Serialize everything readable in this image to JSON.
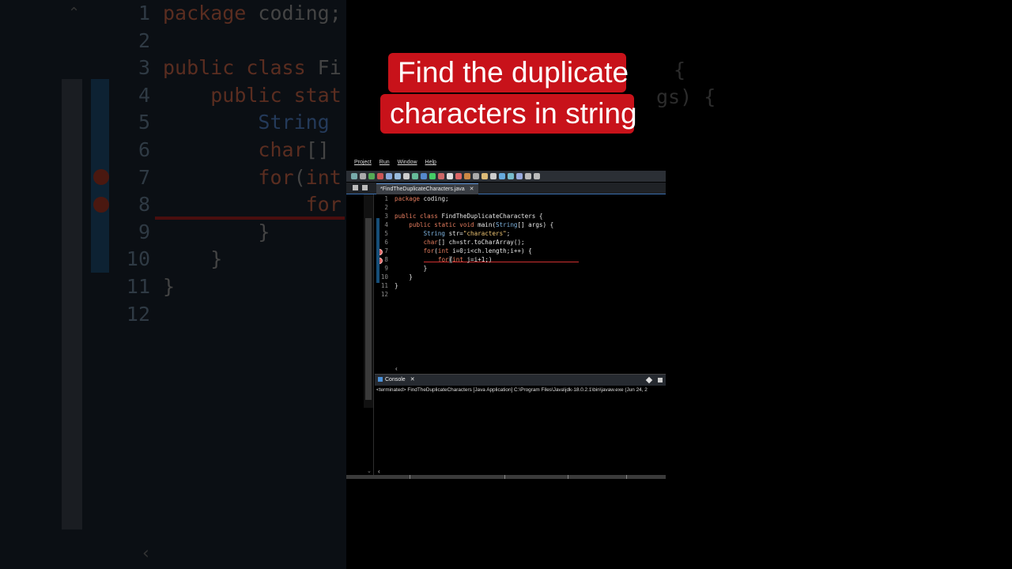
{
  "title": {
    "line1": "Find the duplicate",
    "line2": "characters in string"
  },
  "colors": {
    "banner": "#c8121a",
    "keyword": "#e67d5f",
    "type": "#7fb4e0",
    "string": "#f0c674"
  },
  "menubar": [
    "Project",
    "Run",
    "Window",
    "Help"
  ],
  "editor": {
    "tab_label": "*FindTheDuplicateCharacters.java",
    "tab_close": "✕",
    "lines": [
      {
        "n": "1",
        "html": "<span class=\"kw\">package</span> coding;"
      },
      {
        "n": "2",
        "html": ""
      },
      {
        "n": "3",
        "html": "<span class=\"kw\">public class</span> FindTheDuplicateCharacters {"
      },
      {
        "n": "4",
        "html": "    <span class=\"kw\">public static void</span> main(<span class=\"ty\">String</span>[] args) {"
      },
      {
        "n": "5",
        "html": "        <span class=\"ty\">String</span> str=<span class=\"st\">\"characters\"</span>;"
      },
      {
        "n": "6",
        "html": "        <span class=\"kw\">char</span>[] ch=str.toCharArray();"
      },
      {
        "n": "7",
        "html": "        <span class=\"kw\">for</span>(<span class=\"kw\">int</span> i=0;i&lt;ch.length;i++) {"
      },
      {
        "n": "8",
        "html": "            <span class=\"kw\">for</span><span class=\"hl\">(</span><span class=\"kw\">int</span> j=i+1;)"
      },
      {
        "n": "9",
        "html": "        }"
      },
      {
        "n": "10",
        "html": "    }"
      },
      {
        "n": "11",
        "html": "}"
      },
      {
        "n": "12",
        "html": ""
      }
    ]
  },
  "console": {
    "tab_label": "Console",
    "close": "✕",
    "output": "<terminated> FindTheDuplicateCharacters [Java Application] C:\\Program Files\\Java\\jdk-18.0.2.1\\bin\\javaw.exe  (Jun 24, 2"
  },
  "background": {
    "left_lines": [
      {
        "n": "1",
        "html": "<span class=\"kw\">package</span> coding;"
      },
      {
        "n": "2",
        "html": ""
      },
      {
        "n": "3",
        "html": "<span class=\"kw\">public class</span> Fi"
      },
      {
        "n": "4",
        "html": "    <span class=\"kw\">public stat</span>"
      },
      {
        "n": "5",
        "html": "        <span class=\"ty\">String</span>"
      },
      {
        "n": "6",
        "html": "        <span class=\"kw\">char</span>[]"
      },
      {
        "n": "7",
        "html": "        <span class=\"kw\">for</span>(<span class=\"kw\">int</span>"
      },
      {
        "n": "8",
        "html": "            <span class=\"kw\">for</span>"
      },
      {
        "n": "9",
        "html": "        }"
      },
      {
        "n": "10",
        "html": "    }"
      },
      {
        "n": "11",
        "html": "}"
      },
      {
        "n": "12",
        "html": ""
      }
    ],
    "right_frag1": "{",
    "right_frag2": "gs) {"
  }
}
